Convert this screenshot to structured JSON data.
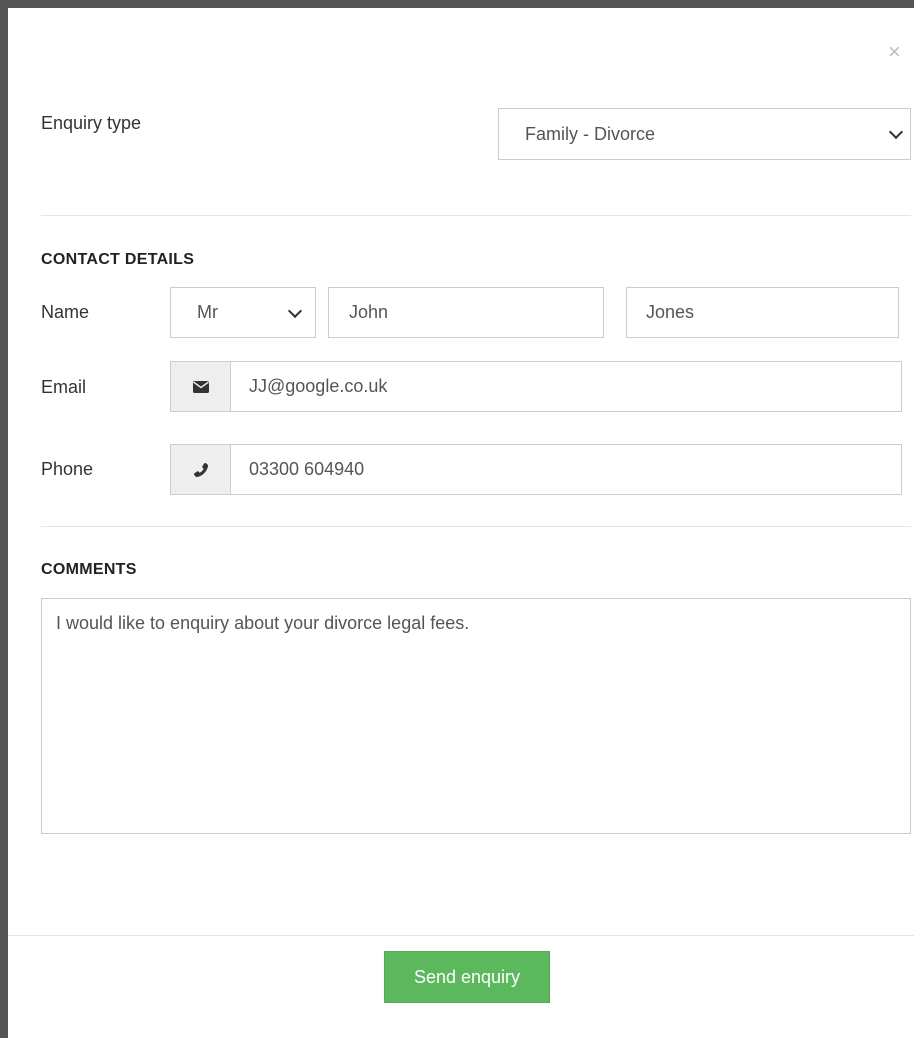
{
  "modal": {
    "close_symbol": "×"
  },
  "enquiry": {
    "label": "Enquiry type",
    "selected": "Family - Divorce"
  },
  "contact": {
    "section_title": "CONTACT DETAILS",
    "name_label": "Name",
    "title_selected": "Mr",
    "first_name": "John",
    "last_name": "Jones",
    "email_label": "Email",
    "email_value": "JJ@google.co.uk",
    "phone_label": "Phone",
    "phone_value": "03300 604940"
  },
  "comments": {
    "section_title": "COMMENTS",
    "value": "I would like to enquiry about your divorce legal fees."
  },
  "footer": {
    "send_label": "Send enquiry",
    "button_color": "#5cb85c"
  },
  "icons": {
    "email": "envelope-icon",
    "phone": "phone-icon",
    "caret": "chevron-down-icon",
    "close": "close-icon"
  }
}
